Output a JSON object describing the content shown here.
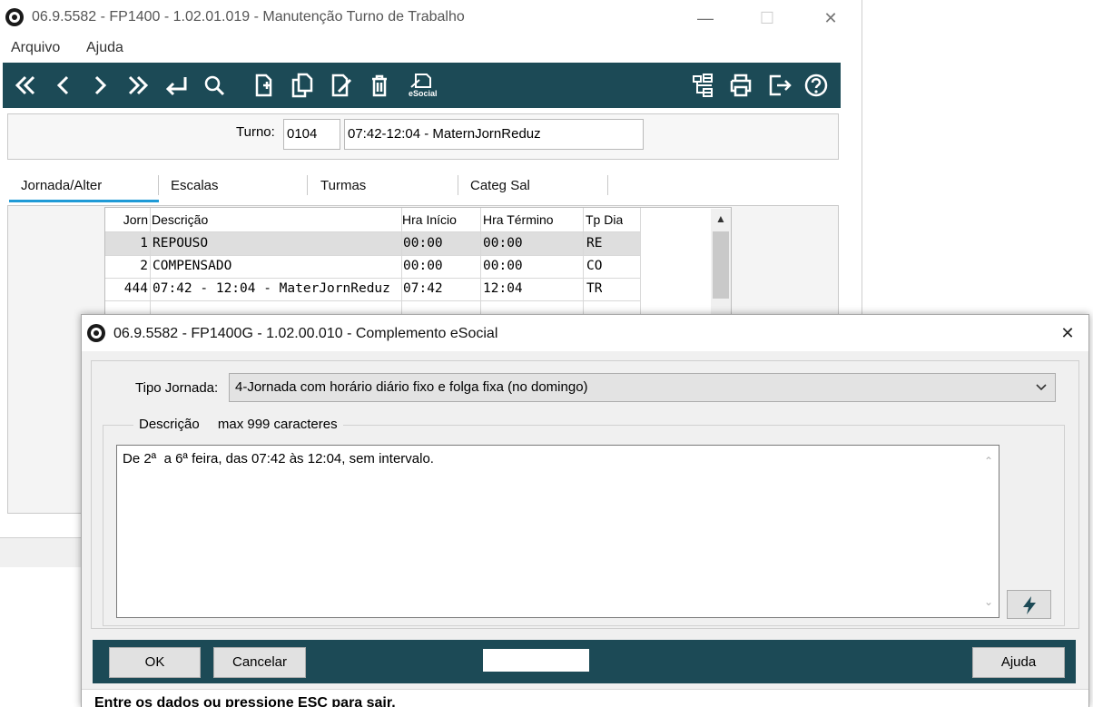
{
  "main_window": {
    "title": "06.9.5582 - FP1400 - 1.02.01.019 - Manutenção Turno de Trabalho",
    "menu": [
      "Arquivo",
      "Ajuda"
    ],
    "toolbar_left_icons": [
      "first-icon",
      "prev-icon",
      "next-icon",
      "last-icon",
      "return-icon",
      "search-icon",
      "new-icon",
      "copy-icon",
      "edit-icon",
      "delete-icon",
      "esocial-icon"
    ],
    "toolbar_esocial_label": "eSocial",
    "toolbar_right_icons": [
      "tree-icon",
      "print-icon",
      "exit-icon",
      "help-icon"
    ],
    "turno": {
      "label": "Turno:",
      "code": "0104",
      "description": "07:42-12:04 - MaternJornReduz"
    },
    "tabs": [
      "Jornada/Alter",
      "Escalas",
      "Turmas",
      "Categ Sal"
    ],
    "active_tab": "Jornada/Alter",
    "grid": {
      "columns": [
        "Jorn",
        "Descrição",
        "Hra Início",
        "Hra Término",
        "Tp Dia"
      ],
      "rows": [
        [
          "1",
          "REPOUSO",
          "00:00",
          "00:00",
          "RE"
        ],
        [
          "2",
          "COMPENSADO",
          "00:00",
          "00:00",
          "CO"
        ],
        [
          "444",
          "07:42 - 12:04 - MaterJornReduz",
          "07:42",
          "12:04",
          "TR"
        ]
      ]
    }
  },
  "dialog": {
    "title": "06.9.5582 - FP1400G - 1.02.00.010 - Complemento eSocial",
    "tipo_jornada_label": "Tipo Jornada:",
    "tipo_jornada_value": "4-Jornada com horário diário fixo e folga fixa (no domingo)",
    "descricao_label": "Descrição",
    "descricao_hint": "max 999 caracteres",
    "descricao_text": "De 2ª  a 6ª feira, das 07:42 às 12:04, sem intervalo.",
    "buttons": {
      "ok": "OK",
      "cancel": "Cancelar",
      "help": "Ajuda"
    },
    "status": "Entre os dados ou pressione ESC para sair."
  },
  "colors": {
    "toolbar_bg": "#1c4a56",
    "tab_accent": "#1f9ad6"
  }
}
